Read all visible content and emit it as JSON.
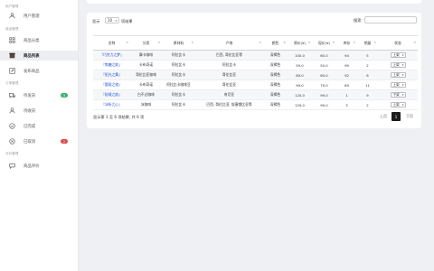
{
  "sidebar": {
    "sections": [
      {
        "title": "用户管理",
        "items": [
          {
            "label": "用户管理",
            "icon": "users-icon"
          }
        ]
      },
      {
        "title": "商品管理",
        "items": [
          {
            "label": "商品分类",
            "icon": "grid-icon"
          },
          {
            "label": "商品列表",
            "icon": "box-icon",
            "active": true
          },
          {
            "label": "发布商品",
            "icon": "edit-icon"
          }
        ]
      },
      {
        "title": "订单管理",
        "items": [
          {
            "label": "待发货",
            "icon": "truck-icon",
            "badge": "3",
            "badge_color": "#3cb371"
          },
          {
            "label": "待收货",
            "icon": "inbox-icon"
          },
          {
            "label": "已完成",
            "icon": "check-circle-icon"
          },
          {
            "label": "已取消",
            "icon": "cancel-circle-icon",
            "badge": "2",
            "badge_color": "#e04a4a"
          }
        ]
      },
      {
        "title": "评价管理",
        "items": [
          {
            "label": "商品评价",
            "icon": "comment-icon"
          }
        ]
      }
    ]
  },
  "table_controls": {
    "show_prefix": "显示",
    "page_length": "10",
    "show_suffix": "项结果",
    "search_label": "搜索:",
    "search_value": ""
  },
  "table": {
    "columns": [
      "名称",
      "分类",
      "原材料",
      "产地",
      "颜色",
      "原价(¥)",
      "现价(¥)",
      "库存",
      "销量",
      "状态"
    ],
    "rows": [
      [
        "『巧克力之梦』",
        "摩卡咖啡",
        "阿拉比卡",
        "巴西, 哥伦比亚等",
        "深褐色",
        "100.0",
        "60.0",
        "94",
        "5",
        "上架"
      ],
      [
        "『焦糖之韵』",
        "卡布奇诺",
        "阿拉比卡",
        "阿拉比卡",
        "深褐色",
        "59.0",
        "50.0",
        "99",
        "2",
        "上架"
      ],
      [
        "『阳光之舞』",
        "哥伦比亚咖啡",
        "阿拉比卡",
        "哥伦比亚",
        "深褐色",
        "89.0",
        "60.0",
        "92",
        "6",
        "上架"
      ],
      [
        "『晨曦之旅』",
        "卡布奇诺",
        "阿拉比卡咖啡豆",
        "哥伦比亚",
        "深褐色",
        "99.0",
        "79.0",
        "89",
        "11",
        "上架"
      ],
      [
        "『秘境之韵』",
        "白不过咖啡",
        "阿拉比卡",
        "肯尼亚",
        "深褐色",
        "120.0",
        "99.0",
        "1",
        "9",
        "下架"
      ],
      [
        "『冰析之心』",
        "冰咖啡",
        "阿拉比卡",
        "巴西, 哥伦比亚, 埃塞俄比亚等",
        "深褐色",
        "129.0",
        "99.0",
        "3",
        "2",
        "上架"
      ]
    ]
  },
  "footer": {
    "info": "显示第 1 至 6 项结果, 共 6 项",
    "prev": "上页",
    "current_page": "1",
    "next": "下页"
  },
  "colors": {
    "accent_dark": "#1a1a1a",
    "link_blue": "#1f4fd8",
    "badge_green": "#3cb371",
    "badge_red": "#e04a4a"
  }
}
